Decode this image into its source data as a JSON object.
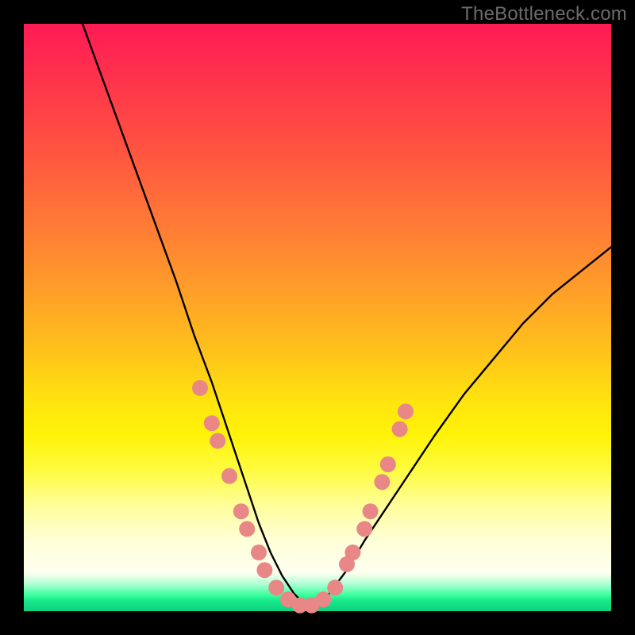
{
  "watermark": "TheBottleneck.com",
  "chart_data": {
    "type": "line",
    "title": "",
    "xlabel": "",
    "ylabel": "",
    "xlim": [
      0,
      100
    ],
    "ylim": [
      0,
      100
    ],
    "grid": false,
    "legend": false,
    "background_gradient": {
      "direction": "vertical",
      "stops": [
        {
          "pos": 0,
          "color": "#ff1a55"
        },
        {
          "pos": 22,
          "color": "#ff5540"
        },
        {
          "pos": 46,
          "color": "#ffa028"
        },
        {
          "pos": 70,
          "color": "#fff308"
        },
        {
          "pos": 88,
          "color": "#ffffd8"
        },
        {
          "pos": 96,
          "color": "#3effa0"
        },
        {
          "pos": 100,
          "color": "#0fd080"
        }
      ]
    },
    "series": [
      {
        "name": "bottleneck-curve",
        "color": "#000000",
        "x": [
          10,
          14,
          18,
          22,
          26,
          29,
          32,
          34,
          36,
          38,
          40,
          42,
          44,
          46,
          48,
          50,
          52,
          55,
          58,
          62,
          66,
          70,
          75,
          80,
          85,
          90,
          95,
          100
        ],
        "y": [
          100,
          89,
          78,
          67,
          56,
          47,
          39,
          33,
          27,
          21,
          15,
          10,
          6,
          3,
          1,
          1,
          3,
          7,
          12,
          18,
          24,
          30,
          37,
          43,
          49,
          54,
          58,
          62
        ]
      }
    ],
    "markers": [
      {
        "name": "left-cluster",
        "color": "#e98787",
        "shape": "circle",
        "r": 10,
        "points": [
          {
            "x": 30,
            "y": 38
          },
          {
            "x": 32,
            "y": 32
          },
          {
            "x": 33,
            "y": 29
          },
          {
            "x": 35,
            "y": 23
          },
          {
            "x": 37,
            "y": 17
          },
          {
            "x": 38,
            "y": 14
          },
          {
            "x": 40,
            "y": 10
          },
          {
            "x": 41,
            "y": 7
          }
        ]
      },
      {
        "name": "bottom-cluster",
        "color": "#e98787",
        "shape": "circle",
        "r": 10,
        "points": [
          {
            "x": 43,
            "y": 4
          },
          {
            "x": 45,
            "y": 2
          },
          {
            "x": 47,
            "y": 1
          },
          {
            "x": 49,
            "y": 1
          },
          {
            "x": 51,
            "y": 2
          },
          {
            "x": 53,
            "y": 4
          }
        ]
      },
      {
        "name": "right-cluster",
        "color": "#e98787",
        "shape": "circle",
        "r": 10,
        "points": [
          {
            "x": 55,
            "y": 8
          },
          {
            "x": 56,
            "y": 10
          },
          {
            "x": 58,
            "y": 14
          },
          {
            "x": 59,
            "y": 17
          },
          {
            "x": 61,
            "y": 22
          },
          {
            "x": 62,
            "y": 25
          },
          {
            "x": 64,
            "y": 31
          },
          {
            "x": 65,
            "y": 34
          }
        ]
      }
    ]
  }
}
